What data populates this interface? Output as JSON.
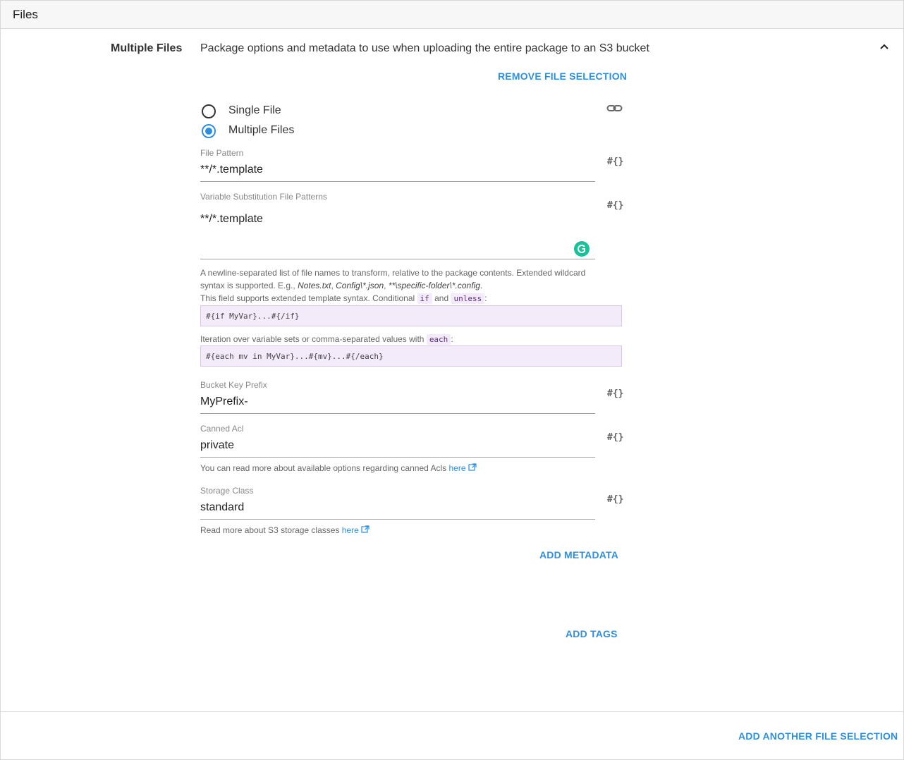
{
  "header": {
    "title": "Files"
  },
  "section": {
    "label": "Multiple Files",
    "description": "Package options and metadata to use when uploading the entire package to an S3 bucket"
  },
  "actions": {
    "remove_file_selection": "REMOVE FILE SELECTION",
    "add_metadata": "ADD METADATA",
    "add_tags": "ADD TAGS",
    "add_another_file_selection": "ADD ANOTHER FILE SELECTION"
  },
  "radio": {
    "single_file": "Single File",
    "multiple_files": "Multiple Files",
    "selected": "multiple_files"
  },
  "fields": {
    "file_pattern": {
      "label": "File Pattern",
      "value": "**/*.template"
    },
    "var_sub": {
      "label": "Variable Substitution File Patterns",
      "value": "**/*.template"
    },
    "bucket_key_prefix": {
      "label": "Bucket Key Prefix",
      "value": "MyPrefix-"
    },
    "canned_acl": {
      "label": "Canned Acl",
      "value": "private"
    },
    "storage_class": {
      "label": "Storage Class",
      "value": "standard"
    }
  },
  "variable_marker": "#{}",
  "help": {
    "var_sub_line1": "A newline-separated list of file names to transform, relative to the package contents. Extended wildcard",
    "var_sub_line2_prefix": "syntax is supported. E.g., ",
    "example_notes": "Notes.txt",
    "example_config": "Config\\*.json",
    "example_specific": "**\\specific-folder\\*.config",
    "comma": ", ",
    "period": ".",
    "template_syntax_prefix": "This field supports extended template syntax. Conditional ",
    "kw_if": "if",
    "and": " and ",
    "kw_unless": "unless",
    "colon": ":",
    "code_if": "#{if MyVar}...#{/if}",
    "iteration_prefix": "Iteration over variable sets or comma-separated values with ",
    "kw_each": "each",
    "code_each": "#{each mv in MyVar}...#{mv}...#{/each}",
    "canned_acl_text": "You can read more about available options regarding canned Acls ",
    "storage_class_text": "Read more about S3 storage classes ",
    "here": "here"
  },
  "colors": {
    "accent": "#2f8fdf",
    "code_bg": "#f3eafa",
    "grammarly": "#15c39a"
  }
}
